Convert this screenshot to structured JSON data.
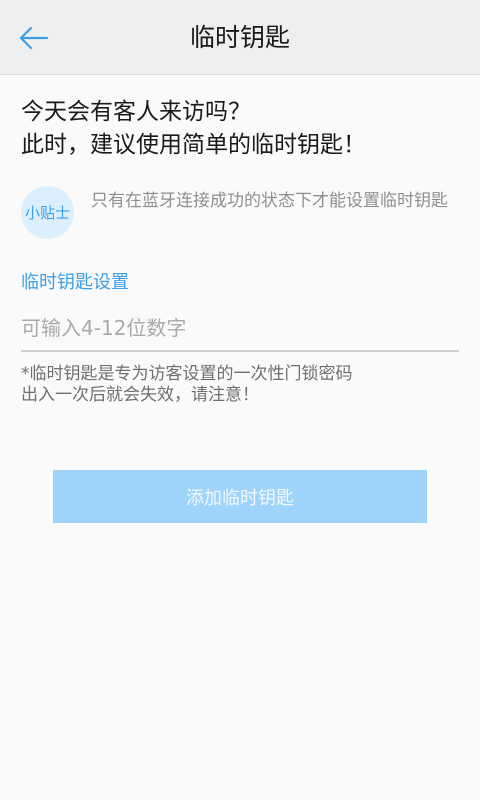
{
  "header": {
    "title": "临时钥匙",
    "back_icon": "arrow-left-icon"
  },
  "intro": {
    "line1": "今天会有客人来访吗？",
    "line2": "此时，建议使用简单的临时钥匙！"
  },
  "tip": {
    "badge_label": "小贴士",
    "text": "只有在蓝牙连接成功的状态下才能设置临时钥匙"
  },
  "key_settings": {
    "label": "临时钥匙设置",
    "input_value": "",
    "input_placeholder": "可输入4-12位数字"
  },
  "note": {
    "line1": "*临时钥匙是专为访客设置的一次性门锁密码",
    "line2": "出入一次后就会失效，请注意！"
  },
  "actions": {
    "add_label": "添加临时钥匙"
  },
  "colors": {
    "accent": "#3d9fe6",
    "button_disabled": "#a0d3fa",
    "header_bg": "#eeeff1"
  }
}
